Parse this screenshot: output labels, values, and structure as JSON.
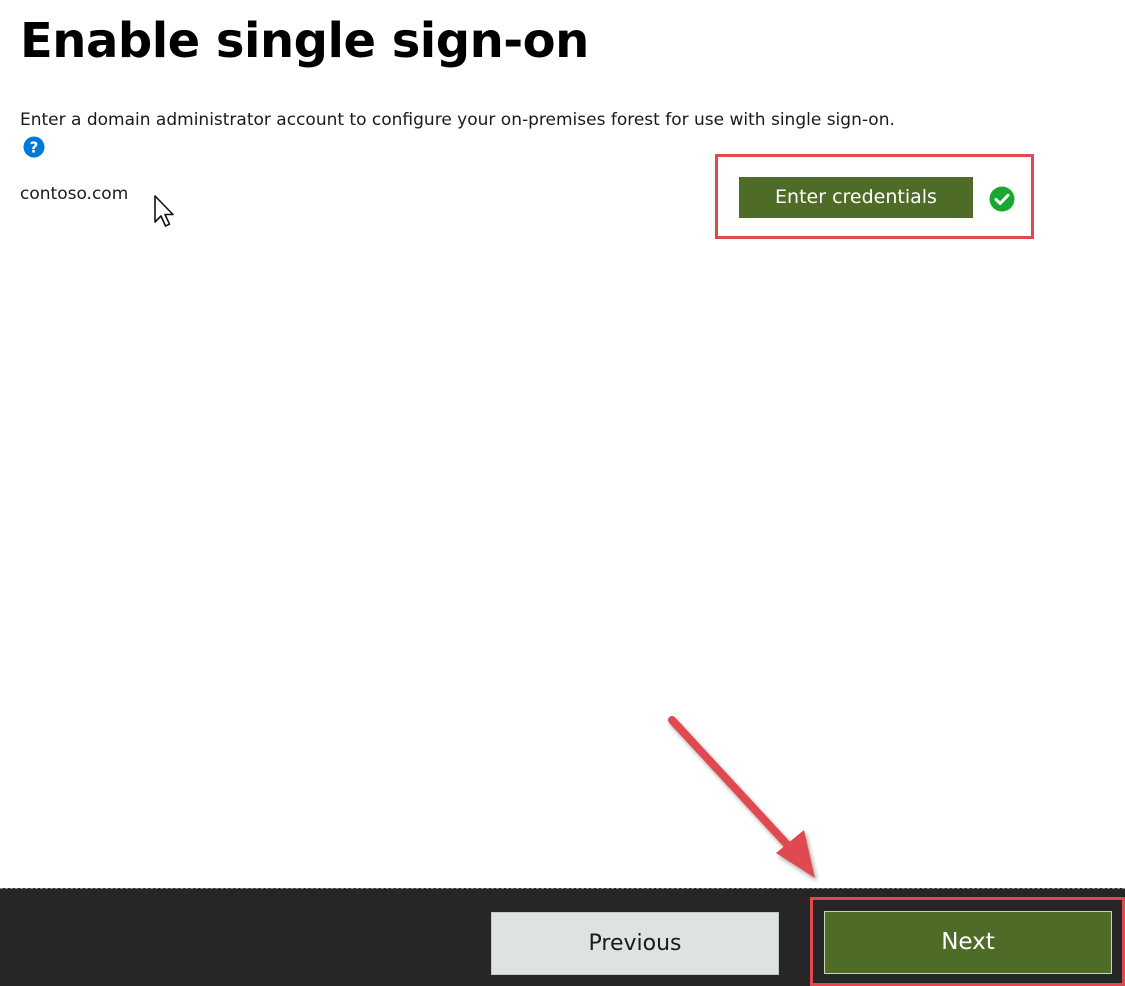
{
  "page": {
    "title": "Enable single sign-on",
    "description": "Enter a domain administrator account to configure your on-premises forest for use with single sign-on."
  },
  "forest": {
    "domain": "contoso.com",
    "credentials_button_label": "Enter credentials",
    "status_icon": "check-circle-icon",
    "status": "success"
  },
  "help": {
    "icon": "help-question-icon"
  },
  "footer": {
    "previous_label": "Previous",
    "next_label": "Next"
  },
  "colors": {
    "accent_green": "#4f6b28",
    "success_green": "#1aa72f",
    "help_blue": "#0078d7",
    "annotation_red": "#e04a4f",
    "footer_background": "#262626",
    "previous_background": "#dfe3e0"
  },
  "annotations": {
    "highlight_boxes": [
      "credentials-button",
      "next-button"
    ],
    "arrow_points_to": "next-button"
  }
}
